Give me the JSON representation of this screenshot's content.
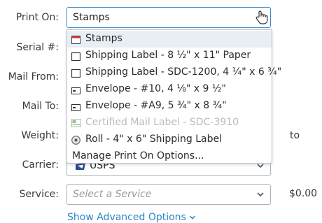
{
  "labels": {
    "print_on": "Print On:",
    "serial": "Serial #:",
    "mail_from": "Mail From:",
    "mail_to": "Mail To:",
    "weight": "Weight:",
    "carrier": "Carrier:",
    "service": "Service:"
  },
  "print_on": {
    "value": "Stamps"
  },
  "carrier": {
    "value": "USPS"
  },
  "service": {
    "placeholder": "Select a Service"
  },
  "price": "$0.00",
  "weight_suffix": "to",
  "advanced_link": "Show Advanced Options",
  "dropdown": {
    "options": [
      {
        "label": "Stamps",
        "icon": "stamp-icon",
        "selected": true,
        "disabled": false
      },
      {
        "label": "Shipping Label - 8 ½\" x 11\" Paper",
        "icon": "label-sheet-icon",
        "selected": false,
        "disabled": false
      },
      {
        "label": "Shipping Label - SDC-1200, 4 ¼\" x 6 ¾\"",
        "icon": "label-sheet-icon",
        "selected": false,
        "disabled": false
      },
      {
        "label": "Envelope - #10, 4 ⅛\" x 9 ½\"",
        "icon": "envelope-icon",
        "selected": false,
        "disabled": false
      },
      {
        "label": "Envelope - #A9, 5 ¾\" x 8 ¾\"",
        "icon": "envelope-icon",
        "selected": false,
        "disabled": false
      },
      {
        "label": "Certified Mail Label - SDC-3910",
        "icon": "certified-label-icon",
        "selected": false,
        "disabled": true
      },
      {
        "label": "Roll - 4\" x 6\" Shipping Label",
        "icon": "roll-icon",
        "selected": false,
        "disabled": false
      }
    ],
    "manage_label": "Manage Print On Options..."
  },
  "colors": {
    "accent": "#2e86c4",
    "focus_border": "#3c8fd0",
    "stamp_red": "#d9363e",
    "selected_bg": "#e9eef5"
  }
}
